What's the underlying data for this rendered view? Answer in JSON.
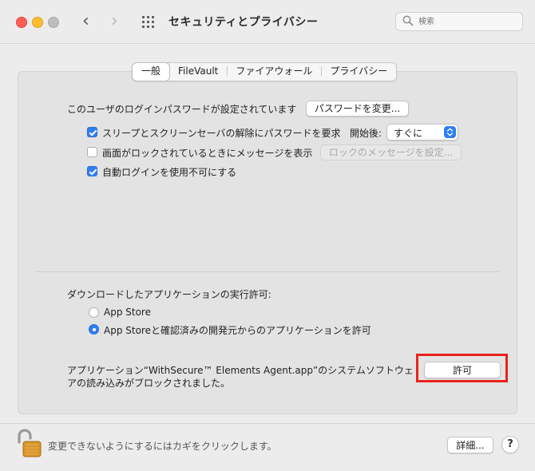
{
  "window": {
    "title": "セキュリティとプライバシー"
  },
  "search": {
    "placeholder": "検索"
  },
  "tabs": [
    {
      "label": "一般",
      "active": true
    },
    {
      "label": "FileVault",
      "active": false
    },
    {
      "label": "ファイアウォール",
      "active": false
    },
    {
      "label": "プライバシー",
      "active": false
    }
  ],
  "general": {
    "password_label": "このユーザのログインパスワードが設定されています",
    "change_password_button": "パスワードを変更...",
    "require_password": {
      "label": "スリープとスクリーンセーバの解除にパスワードを要求",
      "checked": true
    },
    "start_after_label": "開始後:",
    "start_after_value": "すぐに",
    "lock_message": {
      "label": "画面がロックされているときにメッセージを表示",
      "checked": false
    },
    "set_lock_message_button": "ロックのメッセージを設定...",
    "disable_autologin": {
      "label": "自動ログインを使用不可にする",
      "checked": true
    }
  },
  "downloads": {
    "heading": "ダウンロードしたアプリケーションの実行許可:",
    "options": [
      {
        "label": "App Store",
        "selected": false
      },
      {
        "label": "App Storeと確認済みの開発元からのアプリケーションを許可",
        "selected": true
      }
    ]
  },
  "blocked": {
    "line1": "アプリケーション“WithSecure™ Elements Agent.app”のシステムソフトウェ",
    "line2": "アの読み込みがブロックされました。",
    "allow_button": "許可",
    "highlight_color": "#e8231b"
  },
  "footer": {
    "lock_text": "変更できないようにするにはカギをクリックします。",
    "details_button": "詳細...",
    "help_button": "?"
  },
  "colors": {
    "accent": "#2f7ff1"
  },
  "icons": {
    "close": "close-button-icon",
    "minimize": "minimize-button-icon",
    "zoom": "zoom-button-icon",
    "back": "chevron-left-icon",
    "forward": "chevron-right-icon",
    "show_all": "grid-icon",
    "search": "search-icon",
    "lock": "unlocked-padlock-icon",
    "popup": "up-down-chevron-icon"
  }
}
